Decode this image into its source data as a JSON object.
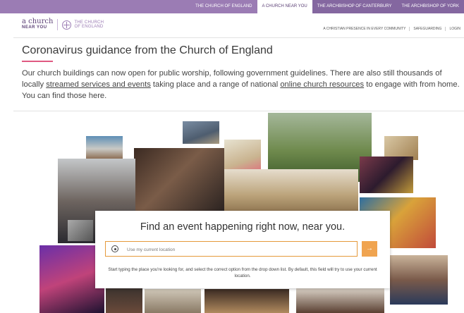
{
  "topnav": {
    "tabs": [
      {
        "label": "THE CHURCH OF ENGLAND"
      },
      {
        "label": "A CHURCH NEAR YOU"
      },
      {
        "label": "THE ARCHBISHOP OF CANTERBURY"
      },
      {
        "label": "THE ARCHBISHOP OF YORK"
      }
    ]
  },
  "logo": {
    "line1": "a church",
    "line2": "NEAR YOU",
    "coe_line1": "THE CHURCH",
    "coe_line2": "OF ENGLAND"
  },
  "utility_links": [
    "A CHRISTIAN PRESENCE IN EVERY COMMUNITY",
    "SAFEGUARDING",
    "LOGIN"
  ],
  "page": {
    "title": "Coronavirus guidance from the Church of England",
    "intro_part1": "Our church buildings can now open for public worship, following government guidelines. There are also still thousands of locally ",
    "intro_link1": "streamed services and events",
    "intro_part2": " taking place and a range of national ",
    "intro_link2": "online church resources",
    "intro_part3": " to engage with from home. You can find those here."
  },
  "search_card": {
    "heading": "Find an event happening right now, near you.",
    "placeholder": "Use my current location",
    "go_icon": "→",
    "help": "Start typing the place you're looking for, and select the correct option from the drop down list. By default, this field will try to use your current location."
  },
  "colors": {
    "nav_purple": "#9b7cb4",
    "accent_pink": "#e05a82",
    "search_orange": "#f0a450"
  }
}
